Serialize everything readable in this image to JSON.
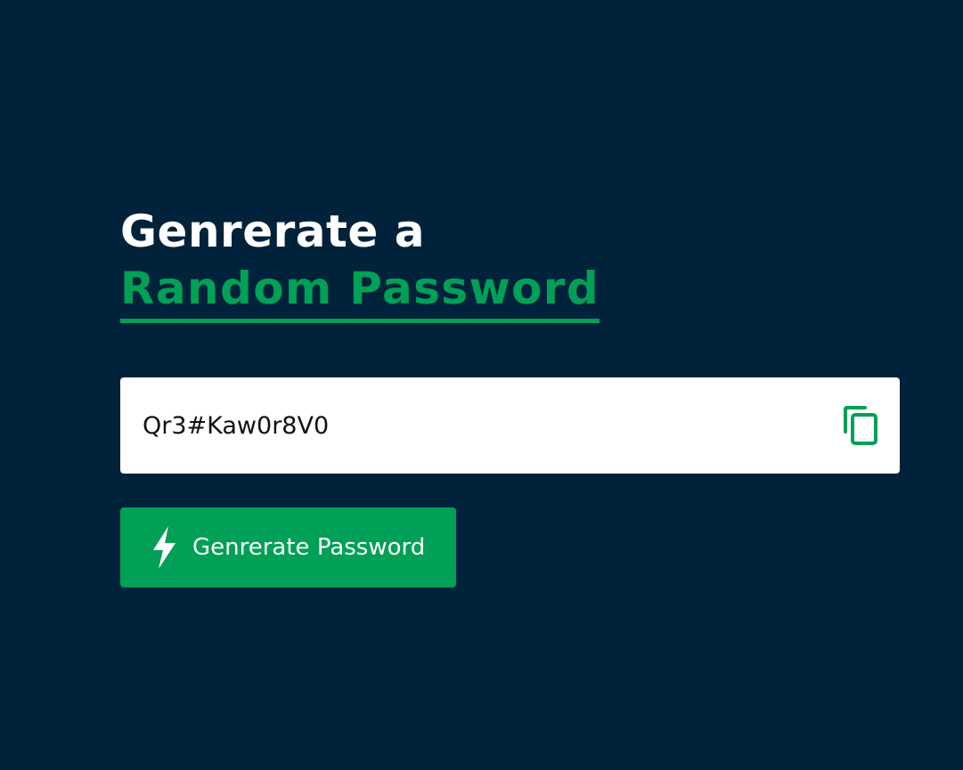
{
  "heading": {
    "line1": "Genrerate a",
    "line2": "Random Password"
  },
  "password": {
    "value": "Qr3#Kaw0r8V0"
  },
  "copy_button": {
    "icon": "copy-icon"
  },
  "generate_button": {
    "label": "Genrerate Password",
    "icon": "lightning-bolt-icon"
  },
  "colors": {
    "background": "#00223a",
    "accent": "#00a056",
    "heading_text": "#ffffff",
    "input_background": "#ffffff"
  }
}
